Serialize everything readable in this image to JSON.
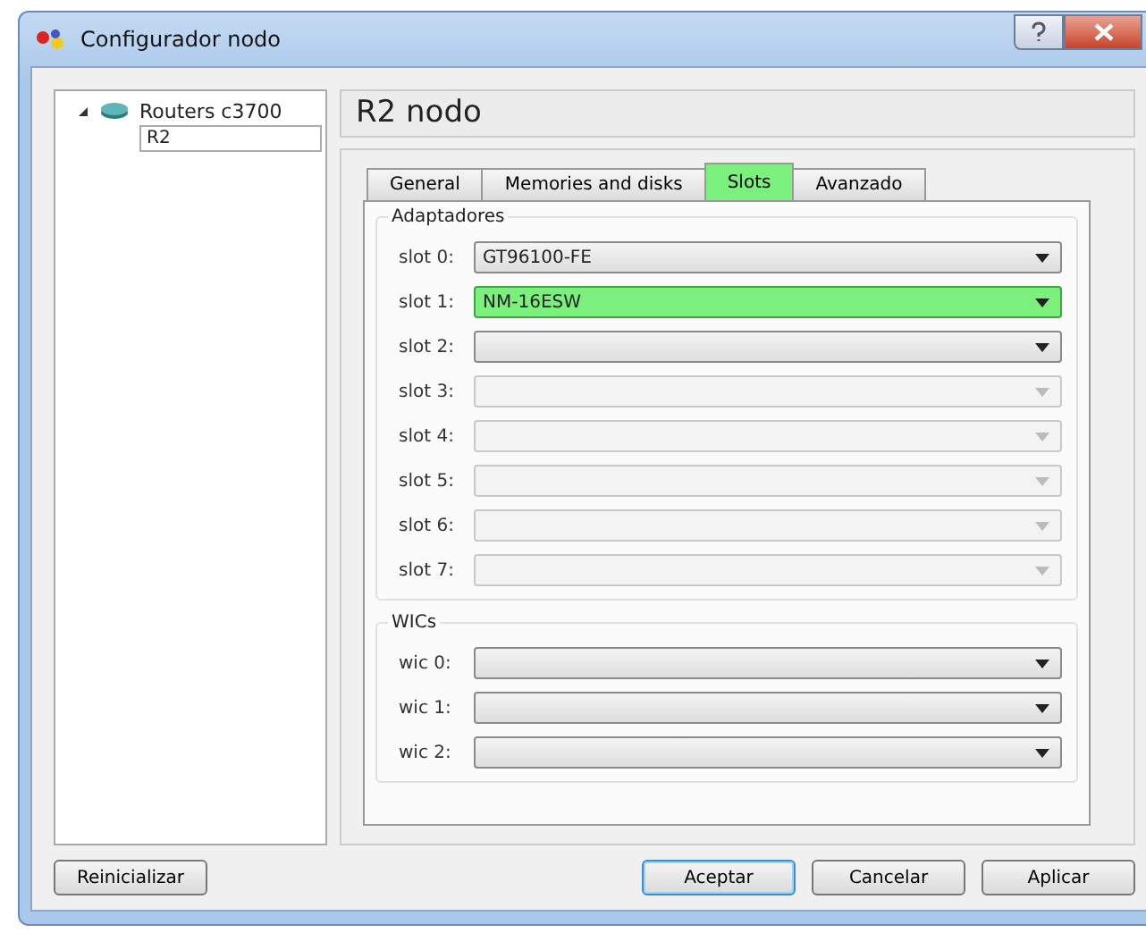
{
  "window": {
    "title": "Configurador nodo"
  },
  "tree": [
    {
      "label": "Routers c3700",
      "expanded": true,
      "children": [
        {
          "label": "R2",
          "selected": true
        }
      ]
    }
  ],
  "header": "R2 nodo",
  "tabs": [
    {
      "label": "General",
      "selected": false
    },
    {
      "label": "Memories and disks",
      "selected": false
    },
    {
      "label": "Slots",
      "selected": true
    },
    {
      "label": "Avanzado",
      "selected": false
    }
  ],
  "groups": [
    {
      "title": "Adaptadores",
      "rows": [
        {
          "label": "slot 0:",
          "value": "GT96100-FE",
          "disabled": false,
          "highlighted": false
        },
        {
          "label": "slot 1:",
          "value": "NM-16ESW",
          "disabled": false,
          "highlighted": true
        },
        {
          "label": "slot 2:",
          "disabled": false,
          "highlighted": false
        },
        {
          "label": "slot 3:",
          "disabled": true,
          "highlighted": false
        },
        {
          "label": "slot 4:",
          "disabled": true,
          "highlighted": false
        },
        {
          "label": "slot 5:",
          "disabled": true,
          "highlighted": false
        },
        {
          "label": "slot 6:",
          "disabled": true,
          "highlighted": false
        },
        {
          "label": "slot 7:",
          "disabled": true,
          "highlighted": false
        }
      ]
    },
    {
      "title": "WICs",
      "rows": [
        {
          "label": "wic 0:",
          "disabled": false,
          "highlighted": false
        },
        {
          "label": "wic 1:",
          "disabled": false,
          "highlighted": false
        },
        {
          "label": "wic 2:",
          "disabled": false,
          "highlighted": false
        }
      ]
    }
  ],
  "left_buttons": [
    {
      "label": "Reinicializar",
      "default": false
    }
  ],
  "buttons": [
    {
      "label": "Aceptar",
      "default": true
    },
    {
      "label": "Cancelar",
      "default": false
    },
    {
      "label": "Aplicar",
      "default": false
    }
  ]
}
